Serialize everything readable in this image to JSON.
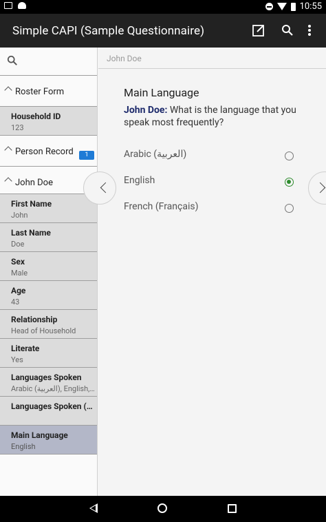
{
  "status": {
    "time": "10:55"
  },
  "appbar": {
    "title": "Simple CAPI (Sample Questionnaire)"
  },
  "sidebar": {
    "groups": [
      {
        "label": "Roster Form"
      },
      {
        "label": "Person Record",
        "badge": "1"
      },
      {
        "label": "John Doe"
      }
    ],
    "household": {
      "label": "Household ID",
      "value": "123"
    },
    "items": [
      {
        "label": "First Name",
        "value": "John"
      },
      {
        "label": "Last Name",
        "value": "Doe"
      },
      {
        "label": "Sex",
        "value": "Male"
      },
      {
        "label": "Age",
        "value": "43"
      },
      {
        "label": "Relationship",
        "value": "Head of Household"
      },
      {
        "label": "Literate",
        "value": "Yes"
      },
      {
        "label": "Languages Spoken",
        "value": "Arabic (العربية), English, ..."
      },
      {
        "label": "Languages Spoken (...",
        "value": ""
      },
      {
        "label": "Main Language",
        "value": "English"
      }
    ]
  },
  "main": {
    "breadcrumb": "John Doe",
    "question": {
      "title": "Main Language",
      "person": "John Doe:",
      "text": "What is the language that you speak most frequently?"
    },
    "options": [
      {
        "label": "Arabic (العربية)",
        "selected": false
      },
      {
        "label": "English",
        "selected": true
      },
      {
        "label": "French (Français)",
        "selected": false
      }
    ]
  },
  "icons": {
    "edit": "edit-note-icon",
    "search": "search-icon",
    "more": "more-vert-icon"
  }
}
